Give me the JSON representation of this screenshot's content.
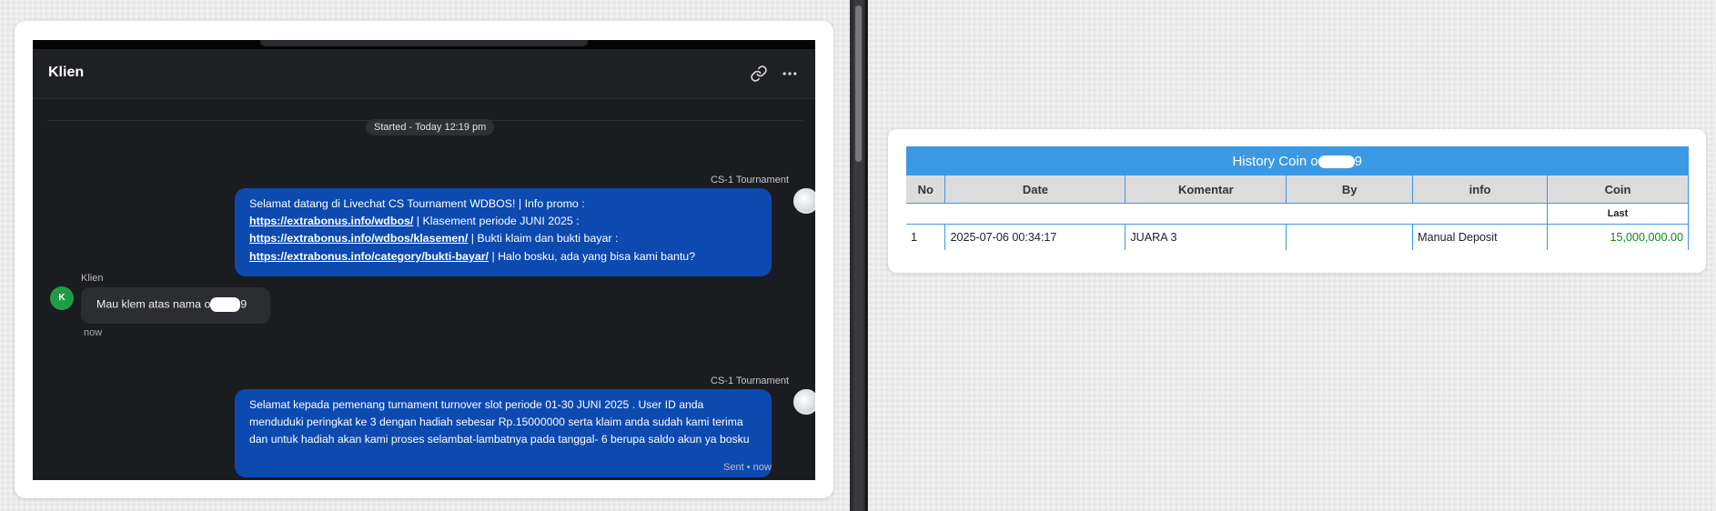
{
  "chat": {
    "header_title": "Klien",
    "header_icons": [
      "link-icon",
      "more-icon"
    ],
    "started_label": "Started - Today 12:19 pm",
    "messages": [
      {
        "sender": "CS-1 Tournament",
        "welcome_text_1": "Selamat datang di Livechat CS Tournament WDBOS! | Info promo :",
        "link_1": "https://extrabonus.info/wdbos/",
        "welcome_text_2": " | Klasement periode JUNI 2025 :",
        "link_2": "https://extrabonus.info/wdbos/klasemen/",
        "welcome_text_3": " | Bukti klaim dan bukti bayar :",
        "link_3": "https://extrabonus.info/category/bukti-bayar/",
        "welcome_text_4": " | Halo bosku, ada yang bisa kami bantu?"
      },
      {
        "sender": "Klien",
        "avatar_initial": "K",
        "text_prefix": "Mau klem atas nama o",
        "text_suffix": "9",
        "time": "now"
      },
      {
        "sender": "CS-1 Tournament",
        "text": "Selamat kepada pemenang turnament turnover slot periode 01-30 JUNI 2025 . User ID anda menduduki peringkat ke 3 dengan hadiah sebesar Rp.15000000 serta klaim anda sudah kami terima dan untuk hadiah akan kami proses selambat-lambatnya pada tanggal- 6 berupa saldo akun ya bosku",
        "status": "Sent • now"
      }
    ]
  },
  "history": {
    "title_prefix": "History Coin o",
    "title_suffix": "9",
    "columns": [
      "No",
      "Date",
      "Komentar",
      "By",
      "info",
      "Coin"
    ],
    "last_label": "Last",
    "rows": [
      {
        "no": "1",
        "date": "2025-07-06 00:34:17",
        "komentar": "JUARA 3",
        "by": "",
        "info": "Manual Deposit",
        "coin": "15,000,000.00"
      }
    ]
  },
  "colors": {
    "agent_bubble": "#0c4ab0",
    "table_header_blue": "#3b99e3",
    "coin_green": "#0b8a1a",
    "client_avatar": "#1f9d46"
  }
}
